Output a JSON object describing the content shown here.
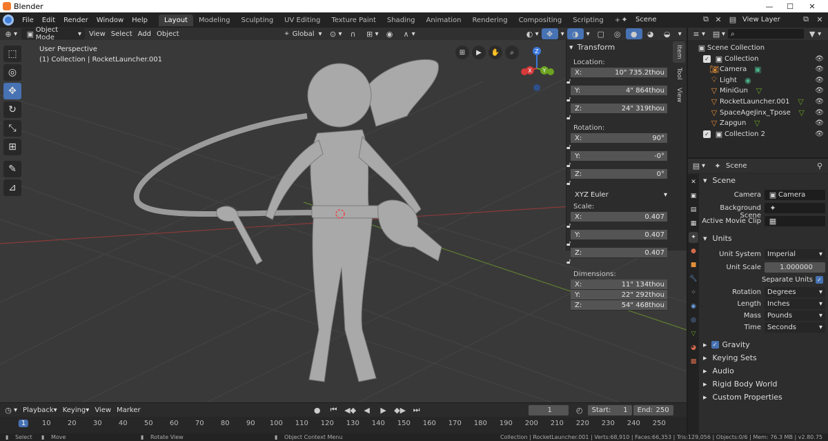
{
  "title_bar": {
    "app_title": "Blender",
    "minimize": "—",
    "maximize": "☐",
    "close": "✕"
  },
  "menus": [
    "File",
    "Edit",
    "Render",
    "Window",
    "Help"
  ],
  "workspaces": [
    "Layout",
    "Modeling",
    "Sculpting",
    "UV Editing",
    "Texture Paint",
    "Shading",
    "Animation",
    "Rendering",
    "Compositing",
    "Scripting"
  ],
  "add_workspace": "+",
  "scene": {
    "name": "Scene",
    "view_layer": "View Layer"
  },
  "viewport_header": {
    "mode": "Object Mode",
    "view": "View",
    "select": "Select",
    "add": "Add",
    "object": "Object",
    "orientation": "Global"
  },
  "viewport": {
    "perspective": "User Perspective",
    "context": "(1) Collection | RocketLauncher.001"
  },
  "gizmo": {
    "x": "X",
    "y": "Y",
    "z": "Z"
  },
  "npanel": {
    "title": "Transform",
    "location_label": "Location:",
    "location": [
      {
        "axis": "X:",
        "value": "10\" 735.2thou"
      },
      {
        "axis": "Y:",
        "value": "4\" 864thou"
      },
      {
        "axis": "Z:",
        "value": "24\" 319thou"
      }
    ],
    "rotation_label": "Rotation:",
    "rotation": [
      {
        "axis": "X:",
        "value": "90°"
      },
      {
        "axis": "Y:",
        "value": "-0°"
      },
      {
        "axis": "Z:",
        "value": "0°"
      }
    ],
    "rotation_mode": "XYZ Euler",
    "scale_label": "Scale:",
    "scale": [
      {
        "axis": "X:",
        "value": "0.407"
      },
      {
        "axis": "Y:",
        "value": "0.407"
      },
      {
        "axis": "Z:",
        "value": "0.407"
      }
    ],
    "dimensions_label": "Dimensions:",
    "dimensions": [
      {
        "axis": "X:",
        "value": "11\" 134thou"
      },
      {
        "axis": "Y:",
        "value": "22\" 292thou"
      },
      {
        "axis": "Z:",
        "value": "54\" 468thou"
      }
    ],
    "tabs": [
      "Item",
      "Tool",
      "View"
    ]
  },
  "outliner": {
    "root": "Scene Collection",
    "items": [
      {
        "name": "Collection",
        "indent": 1,
        "icon": "collection-icon"
      },
      {
        "name": "Camera",
        "indent": 2,
        "icon": "camera-icon"
      },
      {
        "name": "Light",
        "indent": 2,
        "icon": "light-icon"
      },
      {
        "name": "MiniGun",
        "indent": 2,
        "icon": "mesh-icon"
      },
      {
        "name": "RocketLauncher.001",
        "indent": 2,
        "icon": "mesh-icon"
      },
      {
        "name": "SpaceAgeJinx_Tpose",
        "indent": 2,
        "icon": "mesh-icon"
      },
      {
        "name": "Zapgun",
        "indent": 2,
        "icon": "mesh-icon"
      },
      {
        "name": "Collection 2",
        "indent": 1,
        "icon": "collection-icon"
      }
    ]
  },
  "properties": {
    "breadcrumb": "Scene",
    "scene_section": "Scene",
    "camera_label": "Camera",
    "camera_value": "Camera",
    "background_scene_label": "Background Scene",
    "active_movie_clip_label": "Active Movie Clip",
    "units_section": "Units",
    "unit_system_label": "Unit System",
    "unit_system": "Imperial",
    "unit_scale_label": "Unit Scale",
    "unit_scale": "1.000000",
    "separate_units_label": "Separate Units",
    "rotation_label": "Rotation",
    "rotation": "Degrees",
    "length_label": "Length",
    "length": "Inches",
    "mass_label": "Mass",
    "mass": "Pounds",
    "time_label": "Time",
    "time": "Seconds",
    "collapsed": [
      "Gravity",
      "Keying Sets",
      "Audio",
      "Rigid Body World",
      "Custom Properties"
    ]
  },
  "timeline": {
    "playback": "Playback",
    "keying": "Keying",
    "view": "View",
    "marker": "Marker",
    "current_frame": "1",
    "start_label": "Start:",
    "start": "1",
    "end_label": "End:",
    "end": "250",
    "ticks": [
      "1",
      "10",
      "20",
      "30",
      "40",
      "50",
      "60",
      "70",
      "80",
      "90",
      "100",
      "110",
      "120",
      "130",
      "140",
      "150",
      "160",
      "170",
      "180",
      "190",
      "200",
      "210",
      "220",
      "230",
      "240",
      "250"
    ]
  },
  "statusbar": {
    "select": "Select",
    "move": "Move",
    "rotate": "Rotate View",
    "context_menu": "Object Context Menu",
    "stats": "Collection | RocketLauncher.001 | Verts:68,910 | Faces:66,353 | Tris:129,056 | Objects:0/6 | Mem: 76.3 MB | v2.80.75"
  },
  "colors": {
    "accent": "#4772b3",
    "x_axis": "#d63a3a",
    "y_axis": "#6ca321",
    "z_axis": "#3c78d8",
    "header_bg": "#303030",
    "viewport_bg": "#393939"
  }
}
